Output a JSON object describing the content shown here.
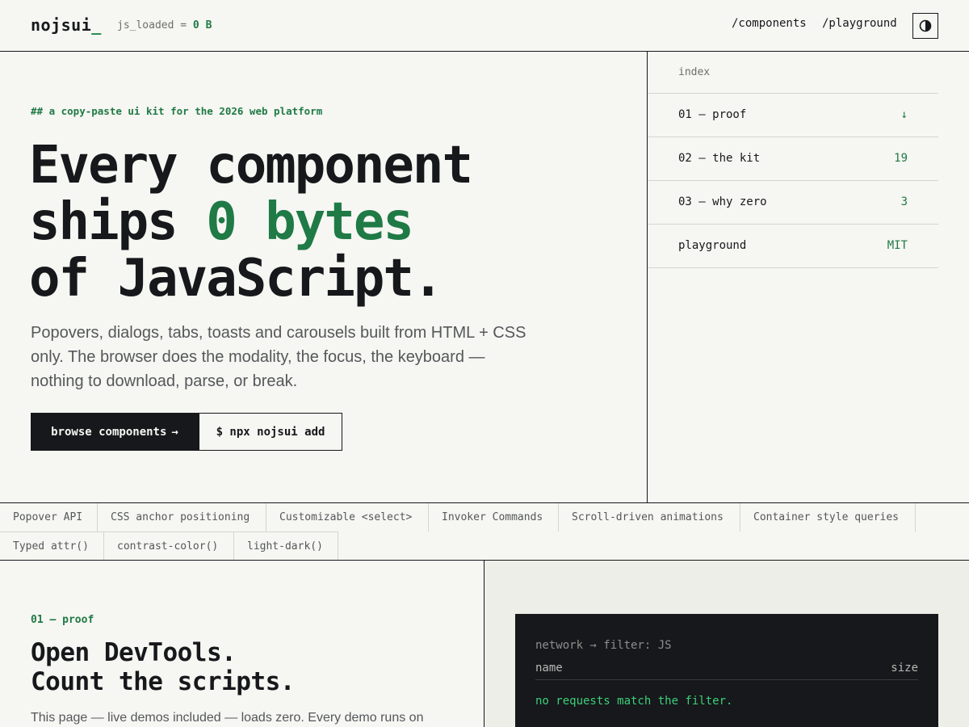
{
  "header": {
    "logo": "nojsui",
    "logo_cursor": "_",
    "js_loaded_label": "js_loaded = ",
    "js_loaded_value": "0 B",
    "nav": [
      {
        "label": "/components"
      },
      {
        "label": "/playground"
      }
    ],
    "theme_toggle_icon": "contrast-icon"
  },
  "hero": {
    "eyebrow": "## a copy-paste ui kit for the 2026 web platform",
    "headline_line1": "Every component",
    "headline_line2_a": "ships ",
    "headline_line2_accent": "0 bytes",
    "headline_line3": "of JavaScript.",
    "lead": "Popovers, dialogs, tabs, toasts and carousels built from HTML + CSS only. The browser does the modality, the focus, the keyboard — nothing to download, parse, or break.",
    "primary_button": "browse components",
    "primary_button_icon": "→",
    "secondary_button": "$ npx nojsui add"
  },
  "index": {
    "title": "index",
    "rows": [
      {
        "label": "01 — proof",
        "value": "↓"
      },
      {
        "label": "02 — the kit",
        "value": "19"
      },
      {
        "label": "03 — why zero",
        "value": "3"
      },
      {
        "label": "playground",
        "value": "MIT"
      }
    ]
  },
  "features": {
    "row1": [
      "Popover API",
      "CSS anchor positioning",
      "Customizable <select>",
      "Invoker Commands",
      "Scroll-driven animations",
      "Container style queries"
    ],
    "row2": [
      "Typed attr()",
      "contrast-color()",
      "light-dark()"
    ]
  },
  "proof": {
    "eyebrow": "01 — proof",
    "title_line1": "Open DevTools.",
    "title_line2": "Count the scripts.",
    "text": "This page — live demos included — loads zero. Every demo runs on",
    "devtools": {
      "filter": "network → filter: JS",
      "col_name": "name",
      "col_size": "size",
      "empty": "no requests match the filter."
    }
  },
  "colors": {
    "accent": "#1f7a45",
    "ink": "#16181b",
    "paper": "#f6f6f2"
  }
}
